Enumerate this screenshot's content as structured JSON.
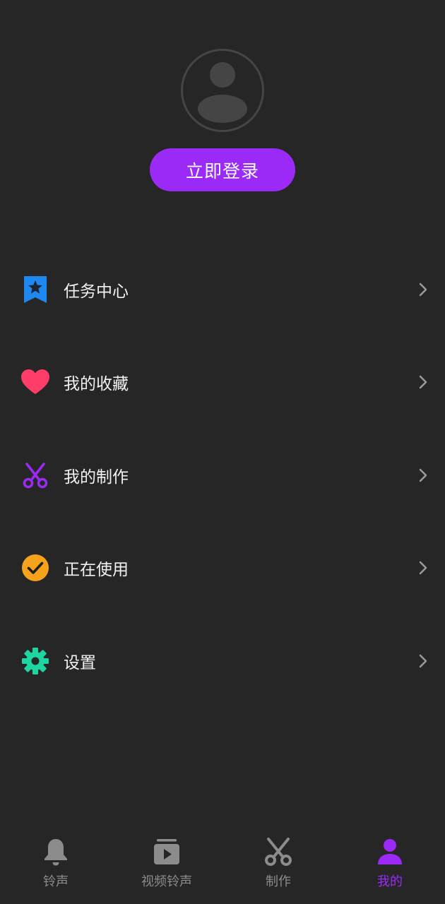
{
  "profile": {
    "login_label": "立即登录"
  },
  "menu": {
    "items": [
      {
        "label": "任务中心",
        "icon": "bookmark-star-icon",
        "color": "#1e88f0"
      },
      {
        "label": "我的收藏",
        "icon": "heart-icon",
        "color": "#ff3d68"
      },
      {
        "label": "我的制作",
        "icon": "scissors-icon",
        "color": "#9b2af6"
      },
      {
        "label": "正在使用",
        "icon": "check-circle-icon",
        "color": "#f6a21d"
      },
      {
        "label": "设置",
        "icon": "gear-icon",
        "color": "#1ed4a0"
      }
    ]
  },
  "tabbar": {
    "tabs": [
      {
        "label": "铃声",
        "icon": "bell-icon",
        "active": false
      },
      {
        "label": "视频铃声",
        "icon": "video-play-icon",
        "active": false
      },
      {
        "label": "制作",
        "icon": "scissors-icon",
        "active": false
      },
      {
        "label": "我的",
        "icon": "person-icon",
        "active": true
      }
    ],
    "active_color": "#9b2af6",
    "inactive_color": "#8c8c8c"
  }
}
